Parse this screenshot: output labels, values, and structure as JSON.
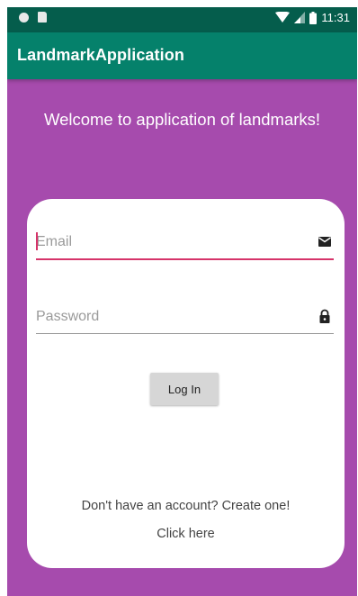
{
  "status_bar": {
    "time": "11:31",
    "background": "#055d4c",
    "icons": [
      "notification-dot-icon",
      "sd-card-icon",
      "wifi-icon",
      "signal-icon",
      "battery-icon"
    ]
  },
  "app_bar": {
    "title": "LandmarkApplication",
    "background": "#05816b"
  },
  "main": {
    "background": "#a64bad",
    "welcome_text": "Welcome to application of landmarks!"
  },
  "login_card": {
    "email": {
      "value": "",
      "placeholder": "Email",
      "icon": "mail-icon",
      "focused": true,
      "accent": "#d6346a"
    },
    "password": {
      "value": "",
      "placeholder": "Password",
      "icon": "lock-icon"
    },
    "login_button_label": "Log In",
    "signup_prompt": "Don't have an account? Create one!",
    "signup_link": "Click here"
  }
}
